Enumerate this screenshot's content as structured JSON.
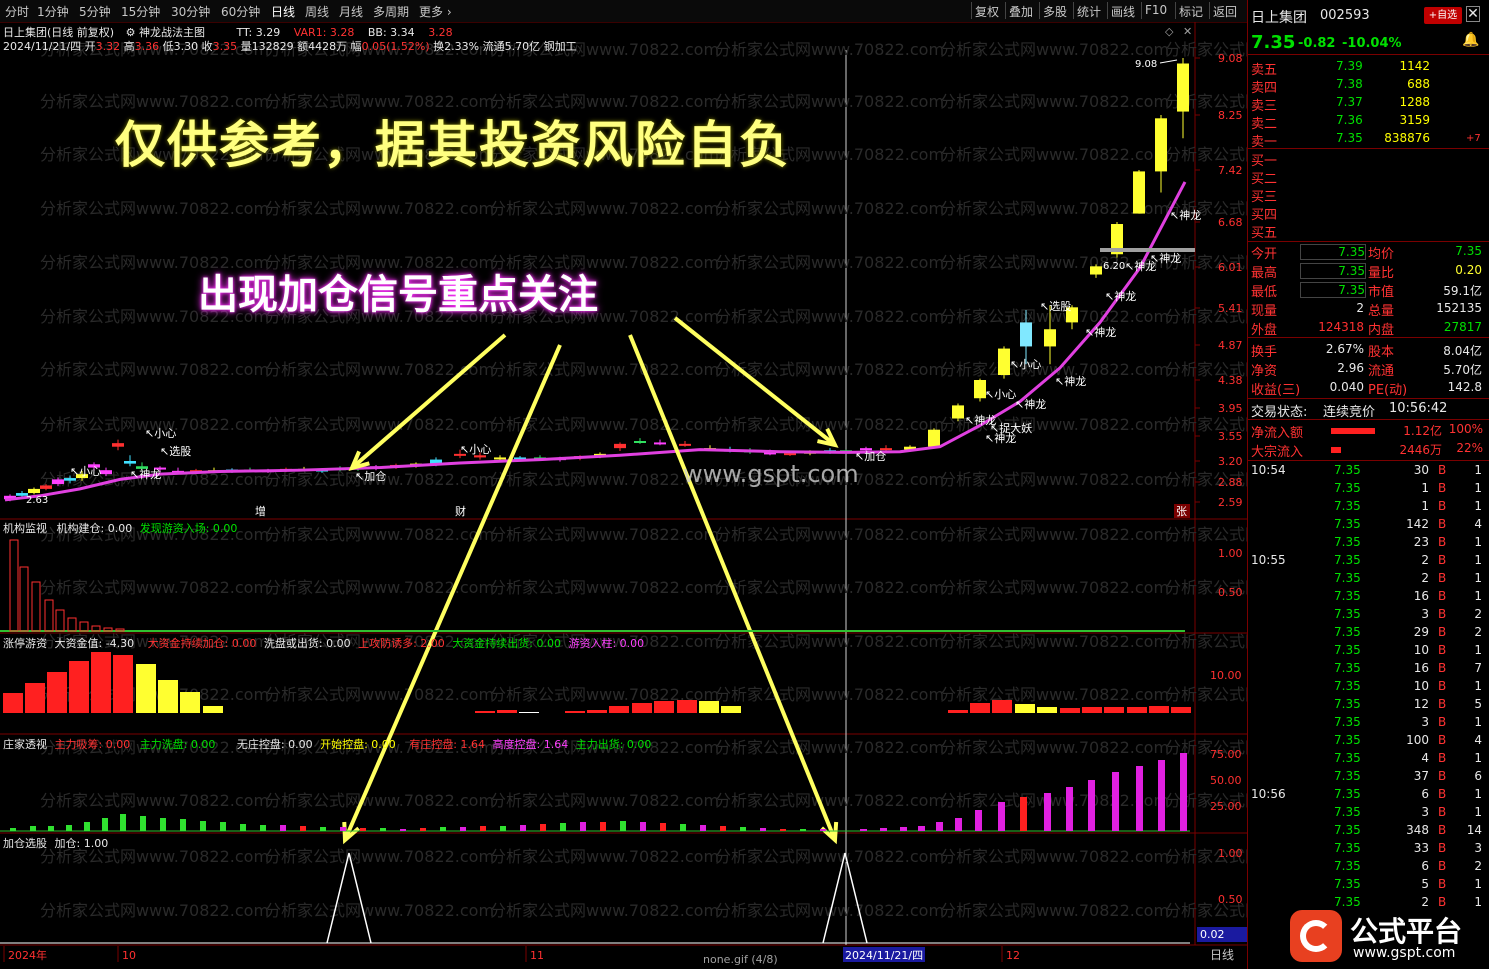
{
  "toolbar": {
    "periods": [
      "分时",
      "1分钟",
      "5分钟",
      "15分钟",
      "30分钟",
      "60分钟",
      "日线",
      "周线",
      "月线",
      "多周期",
      "更多"
    ],
    "right_buttons": [
      "复权",
      "叠加",
      "多股",
      "统计",
      "画线",
      "F10",
      "标记",
      "返回"
    ]
  },
  "stock": {
    "name": "日上集团",
    "code": "002593",
    "price": "7.35",
    "change": "-0.82",
    "pct": "-10.04%",
    "add_watch": "+自选"
  },
  "main_chart": {
    "title": "日上集团(日线 前复权)",
    "indicator": "神龙战法主图",
    "tt": "TT: 3.29",
    "var1": "VAR1: 3.28",
    "bb": "BB: 3.34",
    "extra": "3.28",
    "ohlc_line": {
      "date": "2024/11/21/四",
      "open_l": "开",
      "open": "3.32",
      "high_l": "高",
      "high": "3.36",
      "low_l": "低",
      "low": "3.30",
      "close_l": "收",
      "close": "3.35",
      "vol": "量132829",
      "amt": "额4428万",
      "amp_l": "幅",
      "amp": "0.05(1.52%)",
      "turn": "换2.33%",
      "float": "流通5.70亿",
      "industry": "钢加工"
    },
    "y_ticks": [
      "9.08",
      "8.25",
      "7.42",
      "6.68",
      "6.01",
      "5.41",
      "4.87",
      "4.38",
      "3.95",
      "3.55",
      "3.20",
      "2.88",
      "2.59"
    ],
    "watermark_text": "仅供参考，据其投资风险自负",
    "signal_text": "出现加仓信号重点关注",
    "site": "www.gspt.com",
    "wm_repeat": "分析家公式网www.70822.com",
    "low_label": "2.63",
    "high_label": "9.08",
    "mark_6_20": "6.20",
    "markers_bottom": [
      "增",
      "财",
      "张"
    ],
    "annotations": [
      "加仓",
      "加仓",
      "小心",
      "小心",
      "小心",
      "小心",
      "小心",
      "神龙",
      "神龙",
      "神龙",
      "神龙",
      "神龙",
      "神龙",
      "神龙",
      "神龙",
      "神龙",
      "捉大妖",
      "选股",
      "选股",
      "报大妖"
    ]
  },
  "panel_inst": {
    "title": "机构监视",
    "a": "机构建仓: 0.00",
    "b": "发现游资入场: 0.00",
    "y": [
      "1.00",
      "0.50"
    ]
  },
  "panel_limit": {
    "title": "涨停游资",
    "a": "大资金值: -4.30",
    "b": "大资金持续加仓: 0.00",
    "c": "洗盘或出货: 0.00",
    "d": "上攻防诱多: 2.00",
    "e": "大资金持续出货: 0.00",
    "f": "游资入柱: 0.00",
    "y": [
      "10.00"
    ]
  },
  "panel_dealer": {
    "title": "庄家透视",
    "a": "主力吸筹: 0.00",
    "b": "主力洗盘: 0.00",
    "c": "无庄控盘: 0.00",
    "d": "开始控盘: 0.00",
    "e": "有庄控盘: 1.64",
    "f": "高度控盘: 1.64",
    "g": "主力出货: 0.00",
    "y": [
      "75.00",
      "50.00",
      "25.00"
    ]
  },
  "panel_add": {
    "title": "加仓选股",
    "a": "加仓: 1.00",
    "y": [
      "1.00",
      "0.50"
    ],
    "corner": "0.02"
  },
  "xaxis": {
    "y2024": "2024年",
    "m10": "10",
    "m11": "11",
    "date": "2024/11/21/四",
    "m12": "12",
    "file": "none.gif (4/8)",
    "period": "日线"
  },
  "orderbook": {
    "asks": [
      {
        "l": "卖五",
        "p": "7.39",
        "v": "1142"
      },
      {
        "l": "卖四",
        "p": "7.38",
        "v": "688"
      },
      {
        "l": "卖三",
        "p": "7.37",
        "v": "1288"
      },
      {
        "l": "卖二",
        "p": "7.36",
        "v": "3159"
      },
      {
        "l": "卖一",
        "p": "7.35",
        "v": "838876",
        "d": "+7"
      }
    ],
    "bids": [
      "买一",
      "买二",
      "买三",
      "买四",
      "买五"
    ]
  },
  "stats": [
    {
      "l": "今开",
      "v": "7.35",
      "l2": "均价",
      "v2": "7.35"
    },
    {
      "l": "最高",
      "v": "7.35",
      "l2": "量比",
      "v2": "0.20"
    },
    {
      "l": "最低",
      "v": "7.35",
      "l2": "市值",
      "v2": "59.1亿"
    },
    {
      "l": "现量",
      "v": "2",
      "l2": "总量",
      "v2": "152135"
    },
    {
      "l": "外盘",
      "v": "124318",
      "l2": "内盘",
      "v2": "27817"
    },
    {
      "l": "换手",
      "v": "2.67%",
      "l2": "股本",
      "v2": "8.04亿"
    },
    {
      "l": "净资",
      "v": "2.96",
      "l2": "流通",
      "v2": "5.70亿"
    },
    {
      "l": "收益(三)",
      "v": "0.040",
      "l2": "PE(动)",
      "v2": "142.8"
    }
  ],
  "trade_status": {
    "label": "交易状态:",
    "value": "连续竞价",
    "time": "10:56:42"
  },
  "flows": [
    {
      "l": "净流入额",
      "v": "1.12亿",
      "p": "100%"
    },
    {
      "l": "大宗流入",
      "v": "2446万",
      "p": "22%"
    }
  ],
  "ticks": [
    {
      "t": "10:54",
      "p": "7.35",
      "v": "30",
      "s": "B",
      "n": "1"
    },
    {
      "t": "",
      "p": "7.35",
      "v": "1",
      "s": "B",
      "n": "1"
    },
    {
      "t": "",
      "p": "7.35",
      "v": "1",
      "s": "B",
      "n": "1"
    },
    {
      "t": "",
      "p": "7.35",
      "v": "142",
      "s": "B",
      "n": "4"
    },
    {
      "t": "",
      "p": "7.35",
      "v": "23",
      "s": "B",
      "n": "1"
    },
    {
      "t": "10:55",
      "p": "7.35",
      "v": "2",
      "s": "B",
      "n": "1"
    },
    {
      "t": "",
      "p": "7.35",
      "v": "2",
      "s": "B",
      "n": "1"
    },
    {
      "t": "",
      "p": "7.35",
      "v": "16",
      "s": "B",
      "n": "1"
    },
    {
      "t": "",
      "p": "7.35",
      "v": "3",
      "s": "B",
      "n": "2"
    },
    {
      "t": "",
      "p": "7.35",
      "v": "29",
      "s": "B",
      "n": "2"
    },
    {
      "t": "",
      "p": "7.35",
      "v": "10",
      "s": "B",
      "n": "1"
    },
    {
      "t": "",
      "p": "7.35",
      "v": "16",
      "s": "B",
      "n": "7"
    },
    {
      "t": "",
      "p": "7.35",
      "v": "10",
      "s": "B",
      "n": "1"
    },
    {
      "t": "",
      "p": "7.35",
      "v": "12",
      "s": "B",
      "n": "5"
    },
    {
      "t": "",
      "p": "7.35",
      "v": "3",
      "s": "B",
      "n": "1"
    },
    {
      "t": "",
      "p": "7.35",
      "v": "100",
      "s": "B",
      "n": "4"
    },
    {
      "t": "",
      "p": "7.35",
      "v": "4",
      "s": "B",
      "n": "1"
    },
    {
      "t": "",
      "p": "7.35",
      "v": "37",
      "s": "B",
      "n": "6"
    },
    {
      "t": "10:56",
      "p": "7.35",
      "v": "6",
      "s": "B",
      "n": "1"
    },
    {
      "t": "",
      "p": "7.35",
      "v": "3",
      "s": "B",
      "n": "1"
    },
    {
      "t": "",
      "p": "7.35",
      "v": "348",
      "s": "B",
      "n": "14"
    },
    {
      "t": "",
      "p": "7.35",
      "v": "33",
      "s": "B",
      "n": "3"
    },
    {
      "t": "",
      "p": "7.35",
      "v": "6",
      "s": "B",
      "n": "2"
    },
    {
      "t": "",
      "p": "7.35",
      "v": "5",
      "s": "B",
      "n": "1"
    },
    {
      "t": "",
      "p": "7.35",
      "v": "2",
      "s": "B",
      "n": "1"
    }
  ],
  "logo": {
    "text": "公式平台",
    "url": "www.gspt.com"
  },
  "colors": {
    "bg": "#000000",
    "up": "#ff3232",
    "down": "#00e000",
    "ma": "#e040e0",
    "signal": "#ffff60"
  }
}
